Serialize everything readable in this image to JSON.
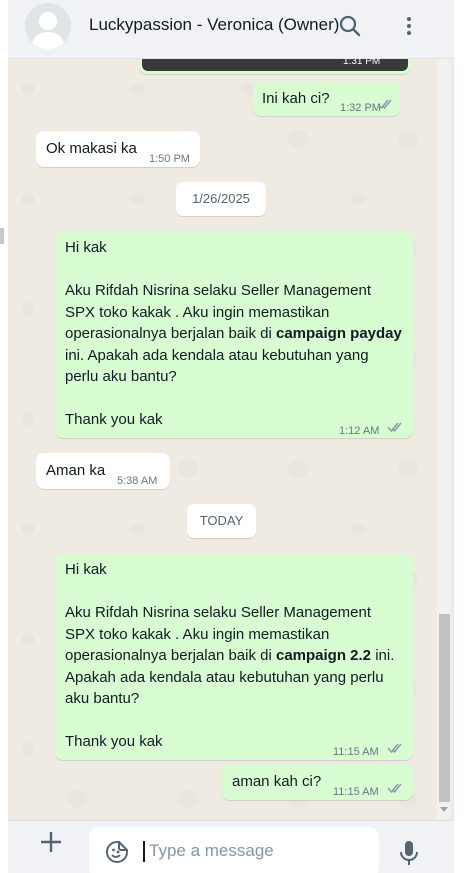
{
  "header": {
    "title": "Luckypassion - Veronica (Owner)",
    "search_icon": "search-icon",
    "menu_icon": "more-vert-icon"
  },
  "image_message": {
    "time": "1:31 PM"
  },
  "messages": [
    {
      "direction": "out",
      "text": "Ini kah ci?",
      "time": "1:32 PM",
      "status": "read"
    },
    {
      "direction": "in",
      "text": "Ok makasi ka",
      "time": "1:50 PM"
    },
    {
      "direction": "out",
      "line1": "Hi kak",
      "p1": "Aku Rifdah Nisrina selaku Seller Management SPX toko kakak . Aku ingin memastikan operasionalnya berjalan baik di",
      "bold": "campaign payday",
      "p2": "ini. Apakah ada kendala atau kebutuhan yang perlu aku bantu?",
      "closing": "Thank you kak",
      "time": "1:12 AM",
      "status": "read"
    },
    {
      "direction": "in",
      "text": "Aman ka",
      "time": "5:38 AM"
    },
    {
      "direction": "out",
      "line1": "Hi kak",
      "p1": "Aku Rifdah Nisrina selaku Seller Management SPX toko kakak . Aku ingin memastikan operasionalnya berjalan baik di",
      "bold": "campaign 2.2",
      "p2": "ini. Apakah ada kendala atau kebutuhan yang perlu aku bantu?",
      "closing": "Thank you kak",
      "time": "11:15 AM",
      "status": "read"
    },
    {
      "direction": "out",
      "text": "aman kah ci?",
      "time": "11:15 AM",
      "status": "read"
    }
  ],
  "date_separators": [
    "1/26/2025",
    "TODAY"
  ],
  "composer": {
    "placeholder": "Type a message",
    "attach_icon": "plus-icon",
    "sticker_icon": "sticker-icon",
    "mic_icon": "mic-icon"
  },
  "colors": {
    "outgoing_bubble": "#d9fdd3",
    "incoming_bubble": "#ffffff",
    "chat_background": "#efeae2",
    "read_ticks": "#8696a0"
  }
}
